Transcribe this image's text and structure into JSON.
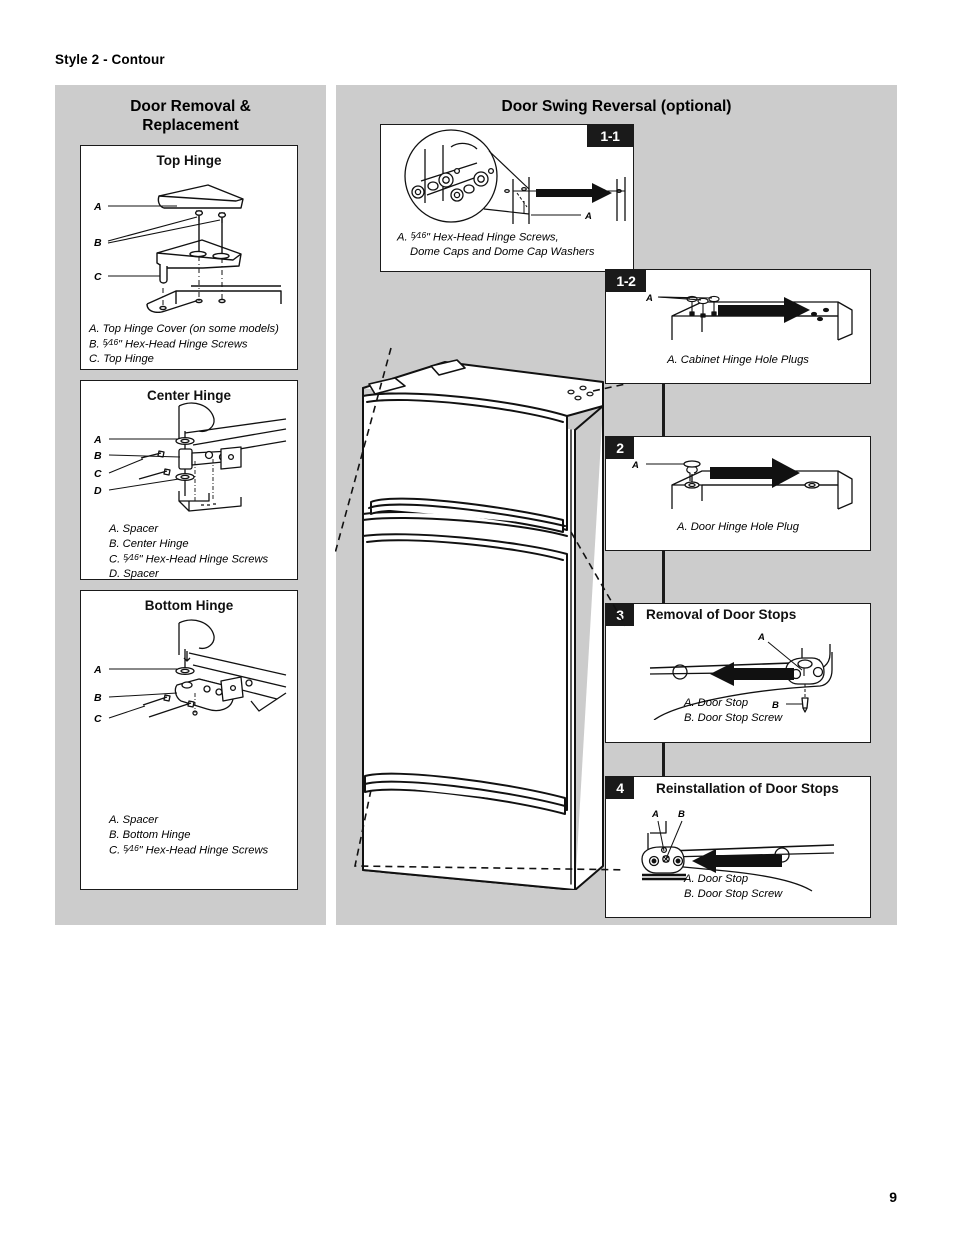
{
  "document": {
    "style_heading": "Style 2 - Contour",
    "page_number": "9"
  },
  "left_panel": {
    "title_line1": "Door Removal &",
    "title_line2": "Replacement",
    "sections": [
      {
        "title": "Top Hinge",
        "legend": [
          "A. Top Hinge Cover (on some models)",
          "B. 5/16\" Hex-Head Hinge Screws",
          "C. Top Hinge"
        ],
        "callouts": [
          "A",
          "B",
          "C"
        ]
      },
      {
        "title": "Center Hinge",
        "legend": [
          "A. Spacer",
          "B. Center Hinge",
          "C. 5/16\" Hex-Head Hinge Screws",
          "D. Spacer"
        ],
        "callouts": [
          "A",
          "B",
          "C",
          "D"
        ]
      },
      {
        "title": "Bottom Hinge",
        "legend": [
          "A. Spacer",
          "B. Bottom Hinge",
          "C. 5/16\" Hex-Head Hinge Screws"
        ],
        "callouts": [
          "A",
          "B",
          "C"
        ]
      }
    ]
  },
  "right_panel": {
    "title": "Door Swing Reversal (optional)",
    "steps": [
      {
        "badge": "1-1",
        "heading": "",
        "legend": [
          "A. 5/16\" Hex-Head Hinge Screws,",
          "Dome Caps and Dome Cap Washers"
        ],
        "callouts": [
          "A"
        ]
      },
      {
        "badge": "1-2",
        "heading": "",
        "legend": [
          "A. Cabinet Hinge Hole Plugs"
        ],
        "callouts": [
          "A"
        ]
      },
      {
        "badge": "2",
        "heading": "",
        "legend": [
          "A. Door Hinge Hole Plug"
        ],
        "callouts": [
          "A"
        ]
      },
      {
        "badge": "3",
        "heading": "Removal of Door Stops",
        "legend": [
          "A. Door Stop",
          "B. Door Stop Screw"
        ],
        "callouts": [
          "A",
          "B"
        ]
      },
      {
        "badge": "4",
        "heading": "Reinstallation of Door Stops",
        "legend": [
          "A. Door Stop",
          "B. Door Stop Screw"
        ],
        "callouts": [
          "A",
          "B"
        ]
      }
    ]
  },
  "illustration": {
    "name": "top-freezer-refrigerator",
    "description": "Line drawing of a top-mount freezer refrigerator with dashed callout leader lines"
  },
  "colors": {
    "panel_background": "#cccccc",
    "box_background": "#ffffff",
    "line": "#1a1a1a",
    "page_background": "#ffffff"
  }
}
